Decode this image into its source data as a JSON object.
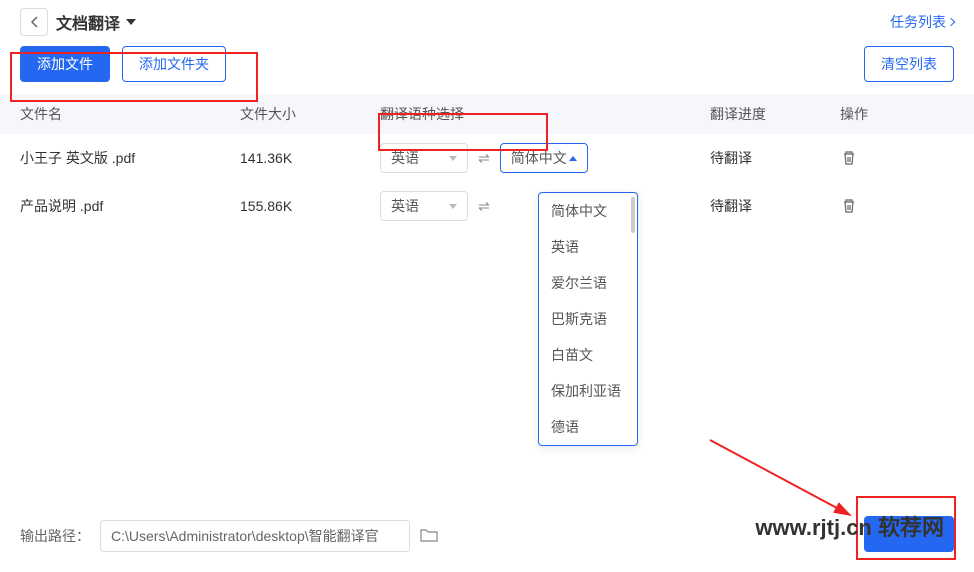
{
  "header": {
    "title": "文档翻译",
    "task_list": "任务列表"
  },
  "toolbar": {
    "add_file": "添加文件",
    "add_folder": "添加文件夹",
    "clear_list": "清空列表"
  },
  "columns": {
    "name": "文件名",
    "size": "文件大小",
    "lang": "翻译语种选择",
    "progress": "翻译进度",
    "action": "操作"
  },
  "rows": [
    {
      "name": "小王子 英文版 .pdf",
      "size": "141.36K",
      "src_lang": "英语",
      "tgt_lang": "简体中文",
      "progress": "待翻译"
    },
    {
      "name": "产品说明 .pdf",
      "size": "155.86K",
      "src_lang": "英语",
      "tgt_lang": "",
      "progress": "待翻译"
    }
  ],
  "dropdown": {
    "options": [
      "简体中文",
      "英语",
      "爱尔兰语",
      "巴斯克语",
      "白苗文",
      "保加利亚语",
      "德语"
    ]
  },
  "footer": {
    "output_label": "输出路径：",
    "output_path": "C:\\Users\\Administrator\\desktop\\智能翻译官"
  },
  "watermark": "www.rjtj.cn 软荐网"
}
